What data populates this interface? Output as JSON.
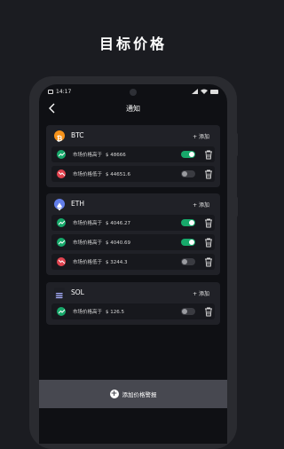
{
  "promo": {
    "title": "目标价格"
  },
  "status": {
    "time": "14:17"
  },
  "header": {
    "title": "通知"
  },
  "cards": [
    {
      "name": "BTC",
      "icon": "bitcoin-icon",
      "icon_color": "#f7931a",
      "add_label": "+ 添加",
      "alerts": [
        {
          "direction": "up",
          "label": "市场价格高于",
          "price": "$ 48666",
          "enabled": true
        },
        {
          "direction": "down",
          "label": "市场价格低于",
          "price": "$ 44651.6",
          "enabled": false
        }
      ]
    },
    {
      "name": "ETH",
      "icon": "ethereum-icon",
      "icon_color": "#627eea",
      "add_label": "+ 添加",
      "alerts": [
        {
          "direction": "up",
          "label": "市场价格高于",
          "price": "$ 4046.27",
          "enabled": true
        },
        {
          "direction": "up",
          "label": "市场价格高于",
          "price": "$ 4040.69",
          "enabled": true
        },
        {
          "direction": "down",
          "label": "市场价格低于",
          "price": "$ 3244.3",
          "enabled": false
        }
      ]
    },
    {
      "name": "SOL",
      "icon": "solana-icon",
      "icon_color": "#1d1e24",
      "add_label": "+ 添加",
      "alerts": [
        {
          "direction": "up",
          "label": "市场价格高于",
          "price": "$ 126.5",
          "enabled": false
        }
      ]
    }
  ],
  "bottom": {
    "label": "添加价格警报"
  },
  "colors": {
    "up": "#17a86a",
    "down": "#e0434f",
    "toggle_on": "#17a86a"
  }
}
